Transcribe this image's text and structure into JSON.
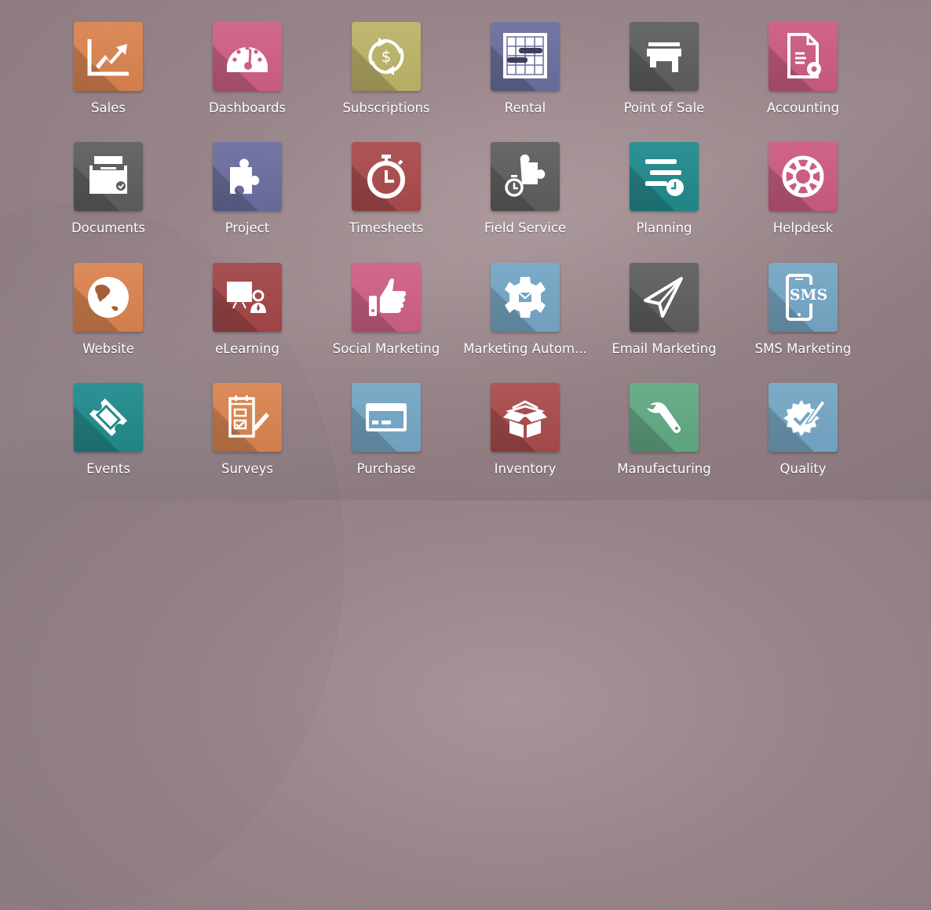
{
  "apps": [
    {
      "label": "Sales",
      "icon": "sales-chart-icon",
      "color": "#d9834f"
    },
    {
      "label": "Dashboards",
      "icon": "speedometer-icon",
      "color": "#cf5f87"
    },
    {
      "label": "Subscriptions",
      "icon": "recurring-dollar-icon",
      "color": "#bcb369"
    },
    {
      "label": "Rental",
      "icon": "gantt-grid-icon",
      "color": "#6b6e9e"
    },
    {
      "label": "Point of Sale",
      "icon": "shop-icon",
      "color": "#5e5e5c"
    },
    {
      "label": "Accounting",
      "icon": "document-gear-icon",
      "color": "#cc5b81"
    },
    {
      "label": "Documents",
      "icon": "file-drawer-check-icon",
      "color": "#5e5e5c"
    },
    {
      "label": "Project",
      "icon": "puzzle-piece-icon",
      "color": "#6b6e9e"
    },
    {
      "label": "Timesheets",
      "icon": "stopwatch-icon",
      "color": "#a94b4c"
    },
    {
      "label": "Field Service",
      "icon": "puzzle-stopwatch-icon",
      "color": "#5e5e5c"
    },
    {
      "label": "Planning",
      "icon": "list-clock-icon",
      "color": "#218a8c"
    },
    {
      "label": "Helpdesk",
      "icon": "lifebuoy-icon",
      "color": "#cc5b81"
    },
    {
      "label": "Website",
      "icon": "globe-icon",
      "color": "#d9834f"
    },
    {
      "label": "eLearning",
      "icon": "presentation-teacher-icon",
      "color": "#a24648"
    },
    {
      "label": "Social Marketing",
      "icon": "thumbs-up-icon",
      "color": "#cf5f87"
    },
    {
      "label": "Marketing Autom...",
      "icon": "gear-envelope-icon",
      "color": "#74a6c4"
    },
    {
      "label": "Email Marketing",
      "icon": "paper-plane-icon",
      "color": "#5e5e5c"
    },
    {
      "label": "SMS Marketing",
      "icon": "phone-sms-icon",
      "color": "#74a6c4"
    },
    {
      "label": "Events",
      "icon": "ticket-icon",
      "color": "#218a8c"
    },
    {
      "label": "Surveys",
      "icon": "checklist-pencil-icon",
      "color": "#d9834f"
    },
    {
      "label": "Purchase",
      "icon": "credit-card-icon",
      "color": "#74a6c4"
    },
    {
      "label": "Inventory",
      "icon": "open-box-icon",
      "color": "#a94b4c"
    },
    {
      "label": "Manufacturing",
      "icon": "wrench-icon",
      "color": "#62a883"
    },
    {
      "label": "Quality",
      "icon": "badge-check-pencil-icon",
      "color": "#74a6c4"
    }
  ],
  "sms_text": "SMS",
  "dollar_text": "$"
}
